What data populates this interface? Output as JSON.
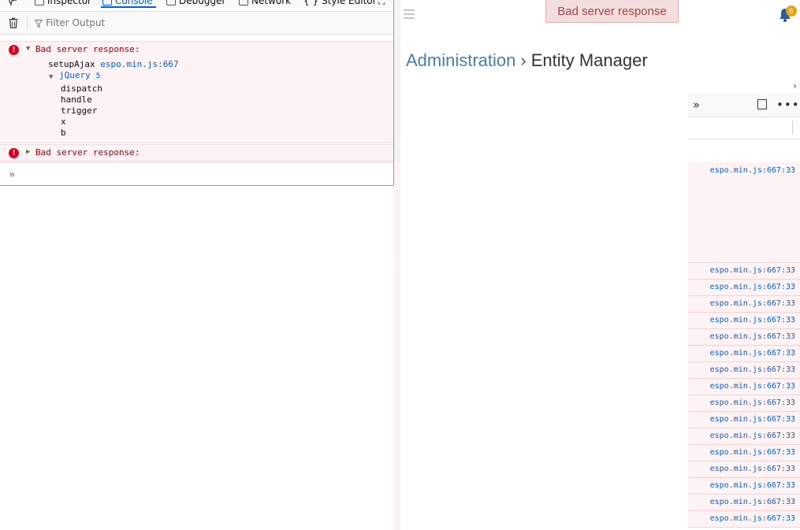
{
  "devtools": {
    "tabs": [
      {
        "label": "Inspector"
      },
      {
        "label": "Console"
      },
      {
        "label": "Debugger"
      },
      {
        "label": "Network"
      },
      {
        "label": "Style Editor"
      }
    ],
    "filter_placeholder": "Filter Output",
    "messages": [
      {
        "text": "Bad server response:",
        "expanded": true,
        "stack_fn": "setupAjax",
        "stack_loc": "espo.min.js:667",
        "group_name": "jQuery",
        "group_count": "5",
        "group_items": [
          "dispatch",
          "handle",
          "trigger",
          "x",
          "b"
        ]
      },
      {
        "text": "Bad server response:",
        "expanded": false
      }
    ]
  },
  "app": {
    "toast": "Bad server response",
    "notification_count": "6",
    "breadcrumb": {
      "parent": "Administration",
      "separator": "›",
      "current": "Entity Manager"
    }
  },
  "right_panel": {
    "log_locations": [
      "espo.min.js:667:33",
      "espo.min.js:667:33",
      "espo.min.js:667:33",
      "espo.min.js:667:33",
      "espo.min.js:667:33",
      "espo.min.js:667:33",
      "espo.min.js:667:33",
      "espo.min.js:667:33",
      "espo.min.js:667:33",
      "espo.min.js:667:33",
      "espo.min.js:667:33",
      "espo.min.js:667:33",
      "espo.min.js:667:33",
      "espo.min.js:667:33",
      "espo.min.js:667:33",
      "espo.min.js:667:33",
      "espo.min.js:667:33"
    ]
  },
  "colors": {
    "toast_bg": "#f2dede",
    "toast_text": "#a94442",
    "link": "#4a7ea8",
    "error_bg": "#fdf2f4",
    "error_text": "#a4000f",
    "devtools_accent": "#0060df",
    "badge": "#e8a40b"
  }
}
